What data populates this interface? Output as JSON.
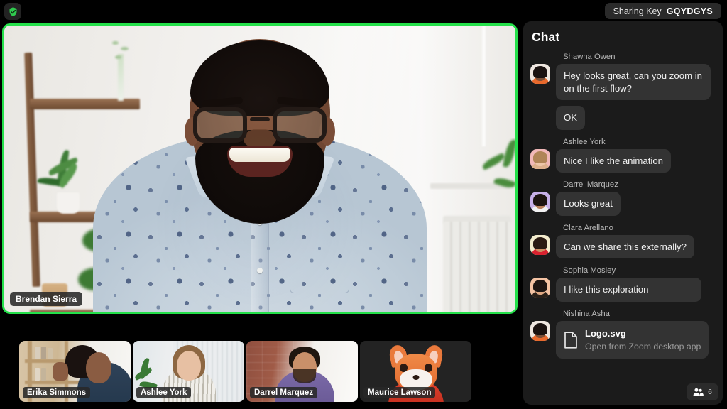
{
  "app": {
    "security_icon": "shield-check-icon",
    "sharing_key_label": "Sharing Key",
    "sharing_key_value": "GQYDGYS",
    "accent_green": "#24e04a",
    "panel_bg": "#1b1b1b",
    "bubble_bg": "#333333"
  },
  "stage": {
    "speaker_name": "Brendan Sierra",
    "active_speaker_highlight": true
  },
  "filmstrip": [
    {
      "name": "Erika Simmons",
      "avatar_type": "video"
    },
    {
      "name": "Ashlee York",
      "avatar_type": "video"
    },
    {
      "name": "Darrel Marquez",
      "avatar_type": "video"
    },
    {
      "name": "Maurice Lawson",
      "avatar_type": "fox-avatar"
    }
  ],
  "chat": {
    "title": "Chat",
    "participants_icon": "people-icon",
    "participants_count": "6",
    "messages": [
      {
        "sender": "Shawna Owen",
        "avatar_bg": "#efe7e0",
        "hair": "#1a1210",
        "skin": "#7a4f37",
        "shirt": "#e8692c",
        "bubbles": [
          "Hey looks great, can you zoom in on the first flow?",
          "OK"
        ]
      },
      {
        "sender": "Ashlee York",
        "avatar_bg": "#f1b8b8",
        "hair": "#b08557",
        "skin": "#edc6a8",
        "shirt": "#ddb08c",
        "bubbles": [
          "Nice I like the animation"
        ]
      },
      {
        "sender": "Darrel Marquez",
        "avatar_bg": "#c7b0e8",
        "hair": "#1c1410",
        "skin": "#b9815c",
        "shirt": "#f2f2f2",
        "bubbles": [
          "Looks great"
        ]
      },
      {
        "sender": "Clara Arellano",
        "avatar_bg": "#f3eccd",
        "hair": "#2a1a12",
        "skin": "#c98f63",
        "shirt": "#d8222f",
        "bubbles": [
          "Can we share this externally?"
        ]
      },
      {
        "sender": "Sophia Mosley",
        "avatar_bg": "#f4c3a3",
        "hair": "#1d1512",
        "skin": "#e0a882",
        "shirt": "#2a2018",
        "bubbles": [
          "I like this exploration"
        ]
      },
      {
        "sender": "Nishina Asha",
        "avatar_bg": "#efe7e0",
        "hair": "#1a1210",
        "skin": "#7a4f37",
        "shirt": "#e8692c",
        "bubbles": [],
        "attachment": {
          "icon": "file-icon",
          "name": "Logo.svg",
          "subtitle": "Open from Zoom desktop app"
        }
      }
    ]
  }
}
